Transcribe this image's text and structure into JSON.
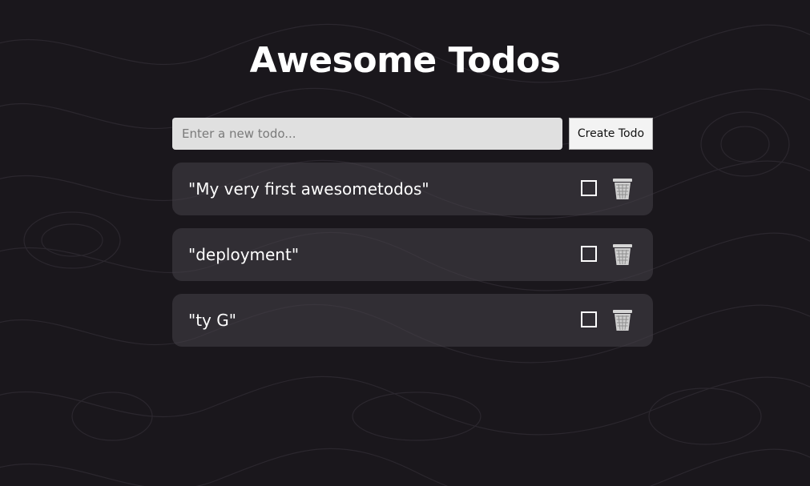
{
  "header": {
    "title": "Awesome Todos"
  },
  "form": {
    "placeholder": "Enter a new todo...",
    "value": "",
    "create_label": "Create Todo"
  },
  "todos": [
    {
      "text": "\"My very first awesometodos\"",
      "completed": false
    },
    {
      "text": "\"deployment\"",
      "completed": false
    },
    {
      "text": "\"ty G\"",
      "completed": false
    }
  ],
  "icons": {
    "toggle": "checkbox-icon",
    "delete": "trash-icon"
  },
  "colors": {
    "background": "#1a171c",
    "card": "#3a373d",
    "text": "#ffffff",
    "input_bg": "#e0e0e0"
  }
}
